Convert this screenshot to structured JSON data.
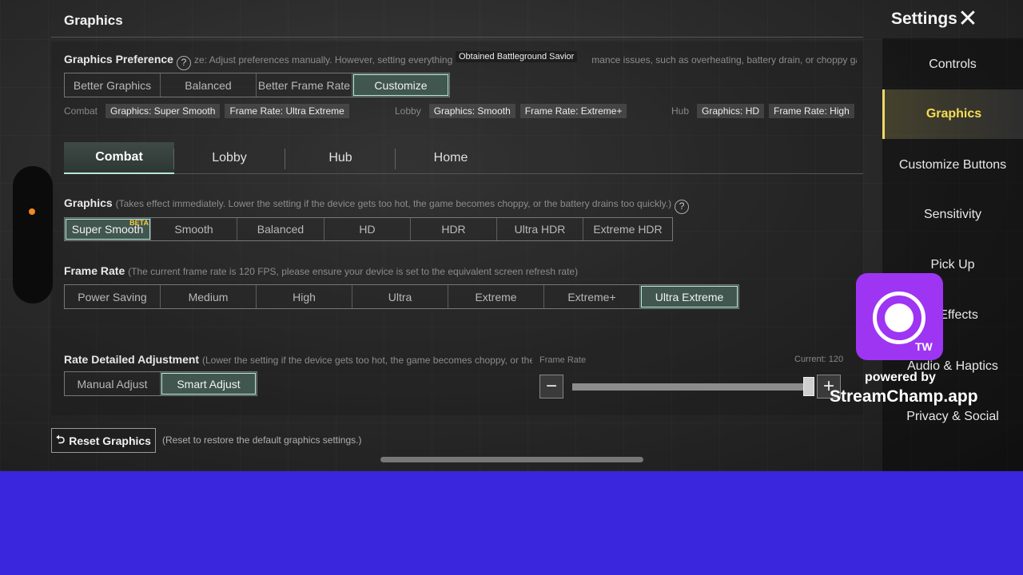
{
  "header": {
    "title": "Graphics"
  },
  "settings": {
    "title": "Settings",
    "close_glyph": "✕"
  },
  "sidebar": {
    "items": [
      {
        "label": "Controls"
      },
      {
        "label": "Graphics"
      },
      {
        "label": "Customize Buttons"
      },
      {
        "label": "Sensitivity"
      },
      {
        "label": "Pick Up"
      },
      {
        "label": "& Effects"
      },
      {
        "label": "Audio & Haptics"
      },
      {
        "label": "Privacy & Social"
      }
    ],
    "active_index": 1
  },
  "toast": {
    "text": "Obtained Battleground Savior"
  },
  "graphics_preference": {
    "label": "Graphics Preference",
    "help_glyph": "?",
    "description": "ze: Adjust preferences manually. However, setting everything",
    "description_tail": "mance issues, such as overheating, battery drain, or choppy gamepl",
    "options": [
      "Better Graphics",
      "Balanced",
      "Better Frame Rate",
      "Customize"
    ],
    "selected": "Customize"
  },
  "presets": {
    "combat": {
      "label": "Combat",
      "graphics": "Graphics: Super Smooth",
      "frame_rate": "Frame Rate: Ultra Extreme"
    },
    "lobby": {
      "label": "Lobby",
      "graphics": "Graphics: Smooth",
      "frame_rate": "Frame Rate: Extreme+"
    },
    "hub": {
      "label": "Hub",
      "graphics": "Graphics: HD",
      "frame_rate": "Frame Rate: High"
    }
  },
  "tabs": {
    "items": [
      "Combat",
      "Lobby",
      "Hub",
      "Home"
    ],
    "selected": "Combat"
  },
  "graphics": {
    "label": "Graphics",
    "description": "(Takes effect immediately. Lower the setting if the device gets too hot, the game becomes choppy, or the battery drains too quickly.)",
    "help_glyph": "?",
    "options": [
      "Super Smooth",
      "Smooth",
      "Balanced",
      "HD",
      "HDR",
      "Ultra HDR",
      "Extreme HDR"
    ],
    "selected": "Super Smooth",
    "beta_badge": "BETA"
  },
  "frame_rate": {
    "label": "Frame Rate",
    "description": "(The current frame rate is 120 FPS, please ensure your device is set to the equivalent screen refresh rate)",
    "options": [
      "Power Saving",
      "Medium",
      "High",
      "Ultra",
      "Extreme",
      "Extreme+",
      "Ultra Extreme"
    ],
    "selected": "Ultra Extreme"
  },
  "rate_adjustment": {
    "label": "Rate Detailed Adjustment",
    "description": "(Lower the setting if the device gets too hot, the game becomes choppy, or the bat",
    "options": [
      "Manual Adjust",
      "Smart Adjust"
    ],
    "selected": "Smart Adjust",
    "slider_label": "Frame Rate",
    "current_label": "Current: 120",
    "minus_glyph": "−",
    "plus_glyph": "+",
    "slider_fraction": 0.98
  },
  "reset": {
    "glyph": "⮌",
    "label": "Reset Graphics",
    "description": "(Reset to restore the default graphics settings.)"
  },
  "overlay": {
    "badge": "TW",
    "powered_by": "powered by",
    "name": "StreamChamp.app"
  }
}
